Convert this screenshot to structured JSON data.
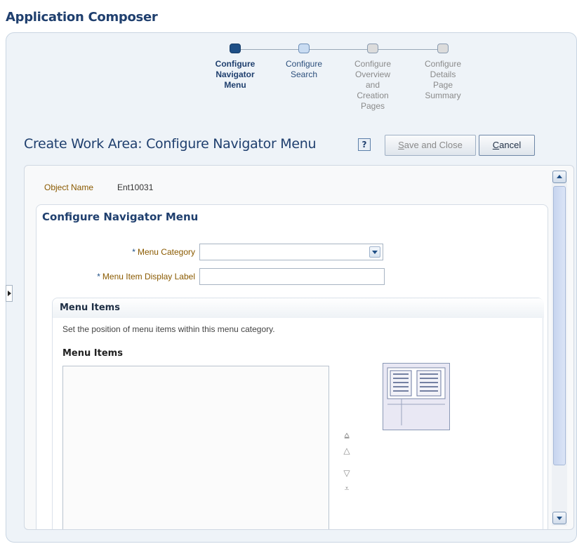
{
  "app": {
    "title": "Application Composer"
  },
  "train": {
    "steps": [
      {
        "lines": [
          "Configure",
          "Navigator",
          "Menu"
        ],
        "state": "current"
      },
      {
        "lines": [
          "Configure",
          "Search"
        ],
        "state": "next"
      },
      {
        "lines": [
          "Configure",
          "Overview",
          "and",
          "Creation",
          "Pages"
        ],
        "state": "disabled"
      },
      {
        "lines": [
          "Configure",
          "Details",
          "Page",
          "Summary"
        ],
        "state": "disabled"
      }
    ]
  },
  "page": {
    "heading": "Create Work Area: Configure Navigator Menu",
    "help_icon": "question-icon",
    "help_glyph": "?",
    "save_close": {
      "access": "S",
      "rest": "ave and Close"
    },
    "cancel": {
      "access": "C",
      "rest": "ancel"
    }
  },
  "object": {
    "label": "Object Name",
    "value": "Ent10031"
  },
  "section": {
    "title": "Configure Navigator Menu",
    "required_marker": "*",
    "menu_category_label": "Menu Category",
    "menu_category_value": "",
    "display_label_label": "Menu Item Display Label",
    "display_label_value": ""
  },
  "menu_items": {
    "header": "Menu Items",
    "instruction": "Set the position of menu items within this menu category.",
    "list_label": "Menu Items",
    "items": [],
    "move_glyphs": {
      "top": "⩠",
      "up": "△",
      "down": "▽",
      "bottom": "⩡"
    }
  },
  "colors": {
    "accent": "#1f4f86",
    "title": "#1f3f6e",
    "label": "#8a5a00"
  }
}
